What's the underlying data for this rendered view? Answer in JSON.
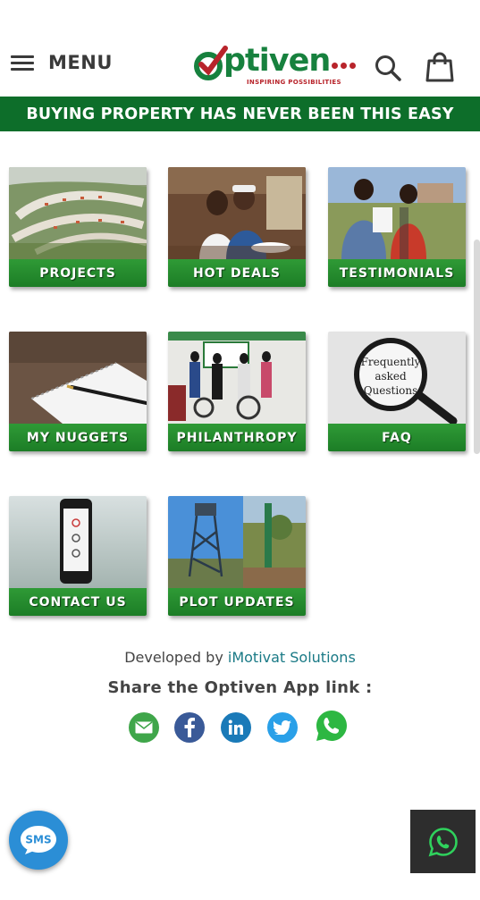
{
  "header": {
    "menu_label": "MENU",
    "logo_text": "ptiven",
    "logo_tagline": "INSPIRING POSSIBILITIES",
    "search_icon": "search-icon",
    "cart_icon": "shopping-bag-icon"
  },
  "banner": {
    "text": "BUYING PROPERTY HAS NEVER BEEN THIS EASY"
  },
  "tiles": [
    {
      "label": "PROJECTS"
    },
    {
      "label": "HOT DEALS"
    },
    {
      "label": "TESTIMONIALS"
    },
    {
      "label": "MY NUGGETS"
    },
    {
      "label": "PHILANTHROPY"
    },
    {
      "label": "FAQ"
    },
    {
      "label": "CONTACT US"
    },
    {
      "label": "PLOT UPDATES"
    }
  ],
  "faq_image_text": [
    "Frequently",
    "asked",
    "Questions"
  ],
  "footer": {
    "developed_by": "Developed by",
    "developer_name": "iMotivat Solutions",
    "share_text": "Share the Optiven App link :",
    "share_icons": [
      "email-icon",
      "facebook-icon",
      "linkedin-icon",
      "twitter-icon",
      "whatsapp-icon"
    ]
  },
  "floating": {
    "sms_label": "SMS",
    "whatsapp_icon": "whatsapp-icon"
  },
  "colors": {
    "brand_green": "#17813e",
    "banner_green": "#0d6e2a",
    "tile_green": "#2f9a36",
    "brand_red": "#b8242b",
    "link_teal": "#1a7a86"
  }
}
